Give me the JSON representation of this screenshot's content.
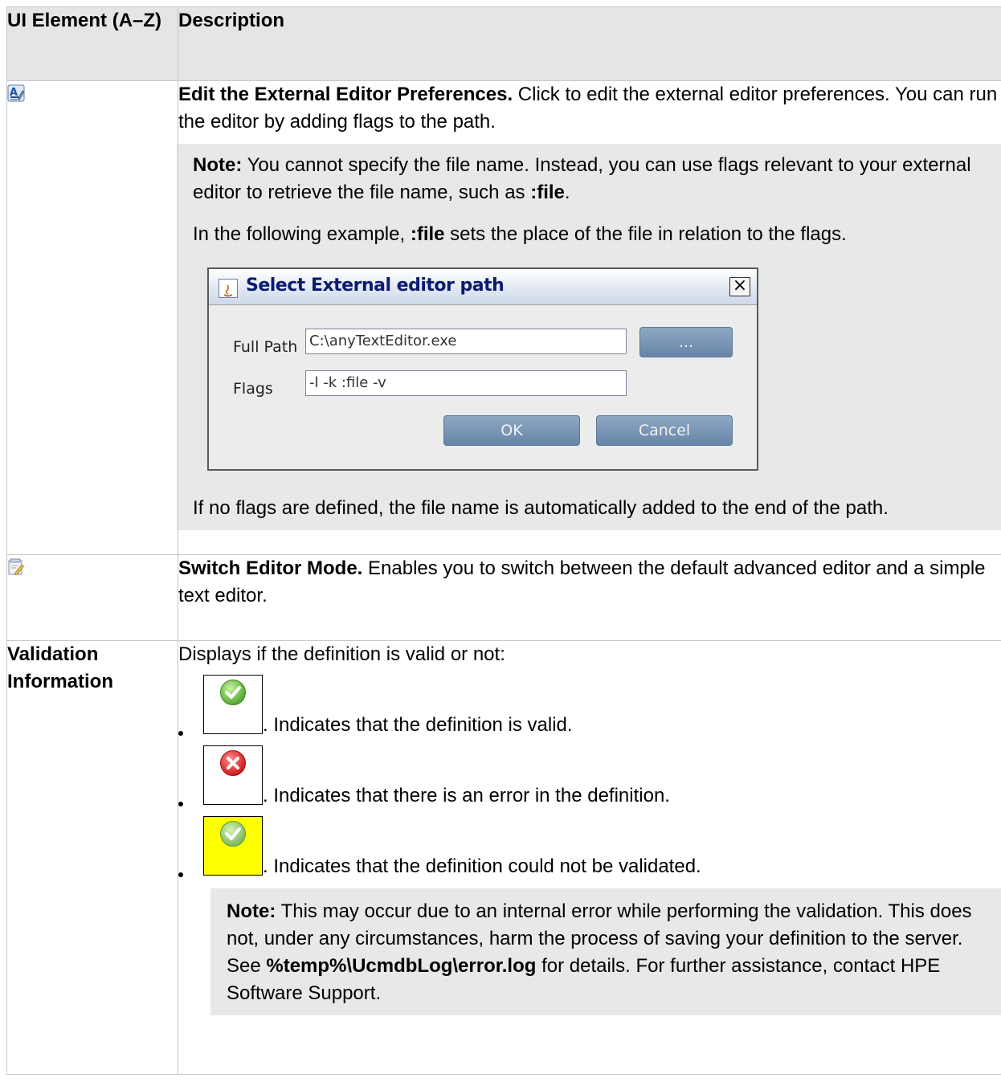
{
  "header": {
    "col1": "UI Element (A–Z)",
    "col2": "Description"
  },
  "rows": [
    {
      "icon": "edit-external-editor-preferences-icon",
      "title": "Edit the External Editor Preferences.",
      "text": " Click to edit the external editor preferences. You can run the editor by adding flags to the path.",
      "note": {
        "label": "Note:",
        "p1_a": " You cannot specify the file name. Instead, you can use flags relevant to your external editor to retrieve the file name, such as ",
        "p1_b": ":file",
        "p1_c": ".",
        "p2_a": "In the following example, ",
        "p2_b": ":file",
        "p2_c": " sets the place of the file in relation to the flags.",
        "p3": "If no flags are defined, the file name is automatically added to the end of the path."
      },
      "dialog": {
        "title": "Select External editor path",
        "full_path_label": "Full Path",
        "full_path_value": "C:\\anyTextEditor.exe",
        "flags_label": "Flags",
        "flags_value": "-l -k :file -v",
        "browse_label": "...",
        "ok_label": "OK",
        "cancel_label": "Cancel"
      }
    },
    {
      "icon": "switch-editor-mode-icon",
      "title": "Switch Editor Mode.",
      "text": " Enables you to switch between the default advanced editor and a simple text editor."
    },
    {
      "element": "Validation Information",
      "intro": "Displays if the definition is valid or not:",
      "items": [
        {
          "icon": "valid-check-icon",
          "text": ". Indicates that the definition is valid."
        },
        {
          "icon": "error-x-icon",
          "text": ". Indicates that there is an error in the definition."
        },
        {
          "icon": "not-validated-check-icon",
          "text": ". Indicates that the definition could not be validated."
        }
      ],
      "note": {
        "label": "Note:",
        "a": " This may occur due to an internal error while performing the validation. This does not, under any circumstances, harm the process of saving your definition to the server. See ",
        "b": "%temp%\\UcmdbLog\\error.log",
        "c": " for details. For further assistance, contact HPE Software Support."
      }
    }
  ],
  "colors": {
    "header_bg": "#e5e5e5",
    "note_bg": "#e7e8e8",
    "border": "#c8c8c8",
    "dialog_title": "#0b1b6e"
  }
}
